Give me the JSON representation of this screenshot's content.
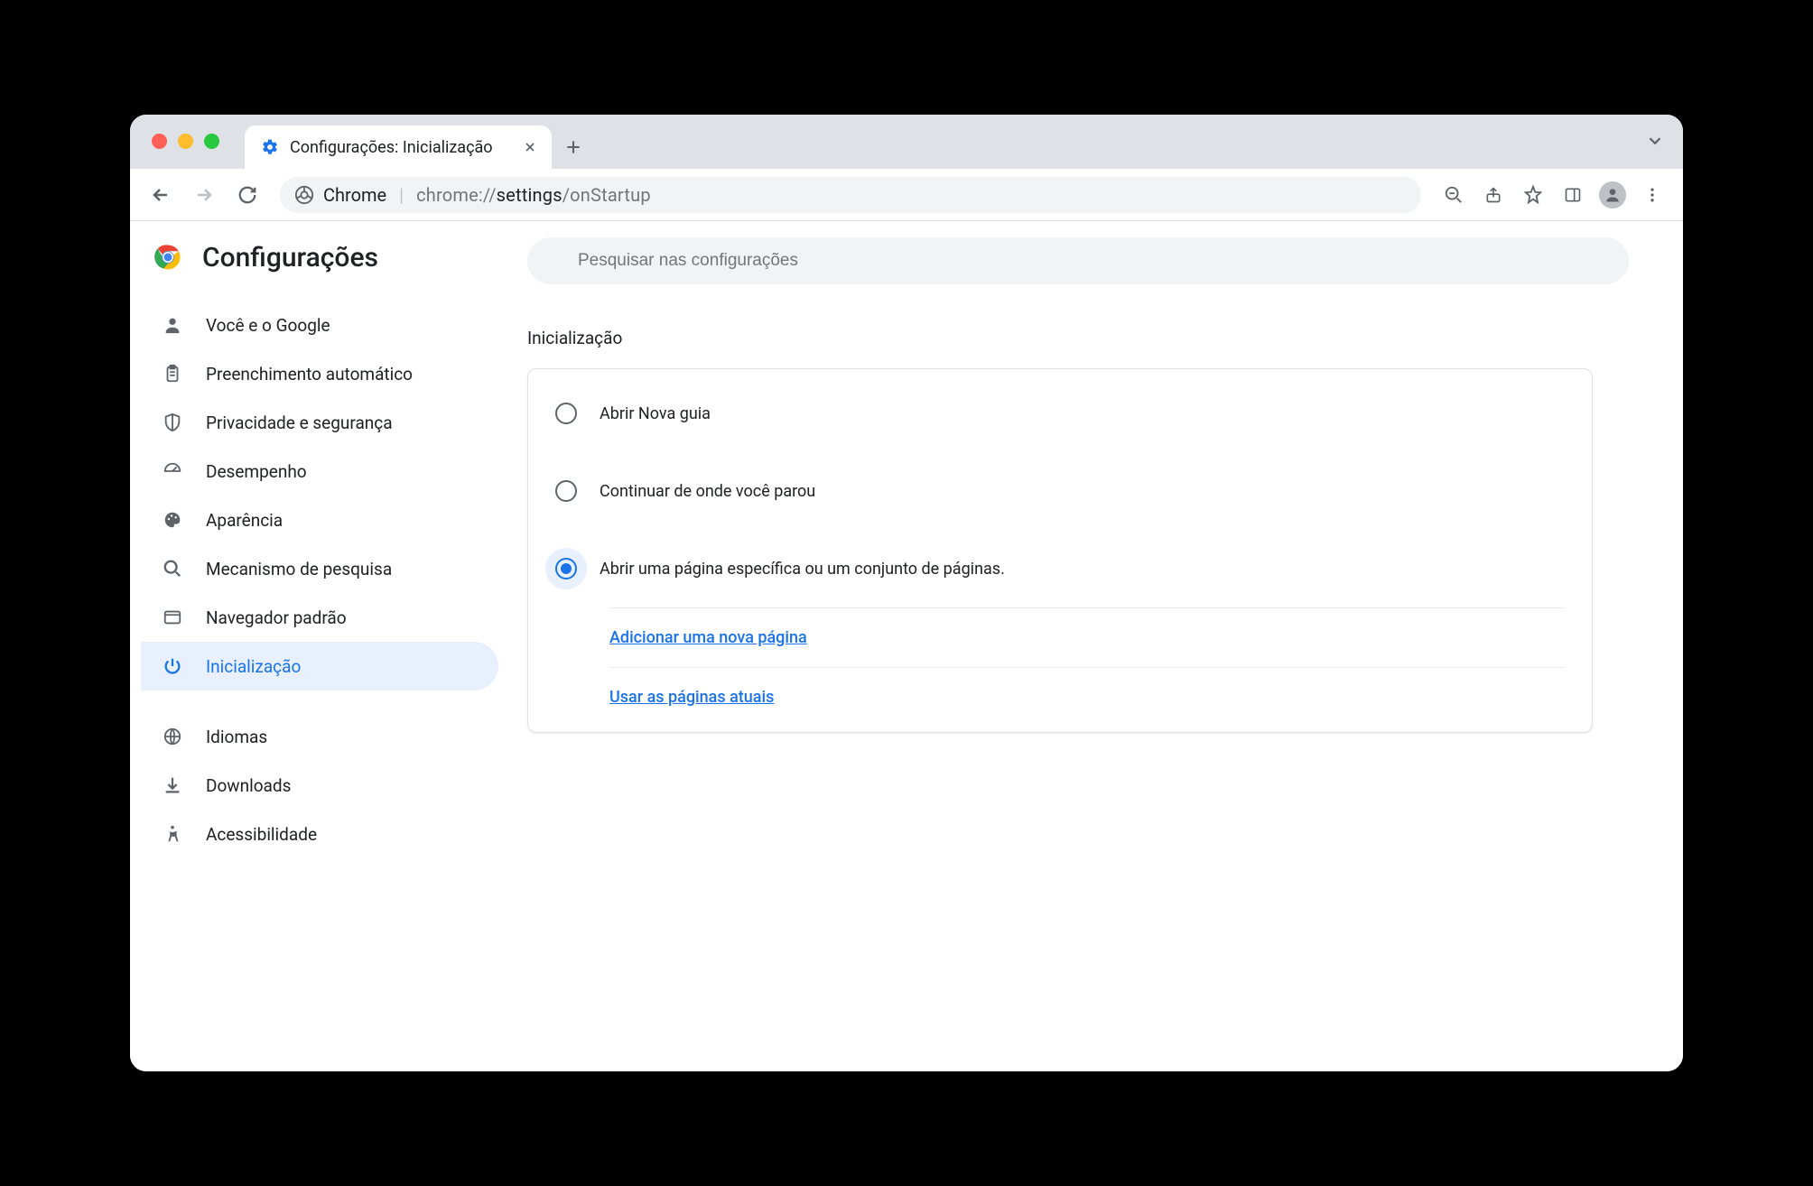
{
  "tab": {
    "title": "Configurações: Inicialização"
  },
  "omnibox": {
    "product": "Chrome",
    "url_prefix": "chrome://",
    "url_bold": "settings",
    "url_rest": "/onStartup"
  },
  "header": {
    "title": "Configurações"
  },
  "search": {
    "placeholder": "Pesquisar nas configurações"
  },
  "sidebar": {
    "items": [
      {
        "label": "Você e o Google",
        "icon": "person"
      },
      {
        "label": "Preenchimento automático",
        "icon": "clipboard"
      },
      {
        "label": "Privacidade e segurança",
        "icon": "shield"
      },
      {
        "label": "Desempenho",
        "icon": "speed"
      },
      {
        "label": "Aparência",
        "icon": "palette"
      },
      {
        "label": "Mecanismo de pesquisa",
        "icon": "search"
      },
      {
        "label": "Navegador padrão",
        "icon": "browser"
      },
      {
        "label": "Inicialização",
        "icon": "power"
      }
    ],
    "lower_items": [
      {
        "label": "Idiomas",
        "icon": "globe"
      },
      {
        "label": "Downloads",
        "icon": "download"
      },
      {
        "label": "Acessibilidade",
        "icon": "accessibility"
      }
    ]
  },
  "section": {
    "title": "Inicialização",
    "options": [
      {
        "label": "Abrir Nova guia",
        "selected": false
      },
      {
        "label": "Continuar de onde você parou",
        "selected": false
      },
      {
        "label": "Abrir uma página específica ou um conjunto de páginas.",
        "selected": true
      }
    ],
    "actions": [
      {
        "label": "Adicionar uma nova página"
      },
      {
        "label": "Usar as páginas atuais"
      }
    ]
  }
}
